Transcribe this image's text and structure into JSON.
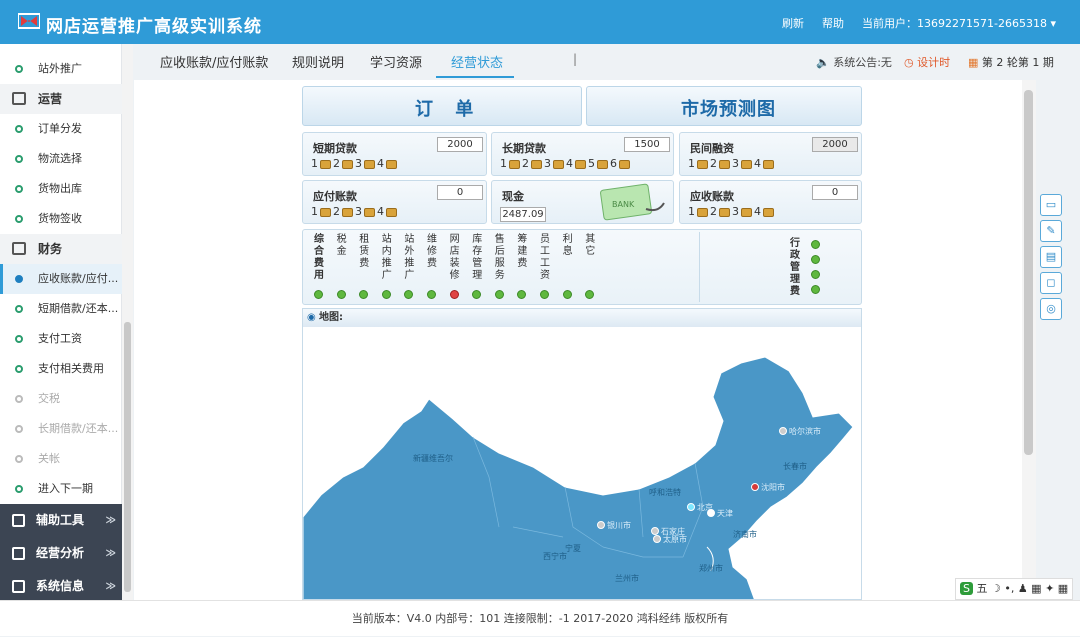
{
  "app": {
    "title": "网店运营推广高级实训系统",
    "refresh": "刷新",
    "help": "帮助",
    "user_label": "当前用户：",
    "user": "13692271571-2665318",
    "user_caret": "▾"
  },
  "sidebar": {
    "items": [
      {
        "label": "站外推广",
        "type": "item"
      },
      {
        "label": "运营",
        "type": "group"
      },
      {
        "label": "订单分发",
        "type": "item"
      },
      {
        "label": "物流选择",
        "type": "item"
      },
      {
        "label": "货物出库",
        "type": "item"
      },
      {
        "label": "货物签收",
        "type": "item"
      },
      {
        "label": "财务",
        "type": "group"
      },
      {
        "label": "应收账款/应付...",
        "type": "active"
      },
      {
        "label": "短期借款/还本...",
        "type": "item"
      },
      {
        "label": "支付工资",
        "type": "item"
      },
      {
        "label": "支付相关费用",
        "type": "item"
      },
      {
        "label": "交税",
        "type": "dim"
      },
      {
        "label": "长期借款/还本...",
        "type": "dim"
      },
      {
        "label": "关帐",
        "type": "dim"
      },
      {
        "label": "进入下一期",
        "type": "item"
      }
    ],
    "bottom": [
      {
        "label": "辅助工具"
      },
      {
        "label": "经营分析"
      },
      {
        "label": "系统信息"
      }
    ],
    "chevron": "≫"
  },
  "tabs": {
    "t1": "应收账款/应付账款",
    "t2": "规则说明",
    "t3": "学习资源",
    "sep": "|",
    "t4": "经营状态"
  },
  "status": {
    "notice": "系统公告:无",
    "timer": "设计时",
    "period": "第 2 轮第 1 期"
  },
  "banners": {
    "order": "订 单",
    "forecast": "市场预测图"
  },
  "finance": {
    "short_loan": {
      "label": "短期贷款",
      "value": "2000",
      "coins": [
        "1",
        "2",
        "3",
        "4"
      ]
    },
    "long_loan": {
      "label": "长期贷款",
      "value": "1500",
      "coins": [
        "1",
        "2",
        "3",
        "4",
        "5",
        "6"
      ]
    },
    "private_fund": {
      "label": "民间融资",
      "value": "2000",
      "coins": [
        "1",
        "2",
        "3",
        "4"
      ]
    },
    "payable": {
      "label": "应付账款",
      "value": "0",
      "coins": [
        "1",
        "2",
        "3",
        "4"
      ]
    },
    "cash": {
      "label": "现金",
      "value": "2487.09",
      "bank": "BANK"
    },
    "receivable": {
      "label": "应收账款",
      "value": "0",
      "coins": [
        "1",
        "2",
        "3",
        "4"
      ]
    }
  },
  "fees": {
    "columns": [
      {
        "label": "综合费用",
        "status": "green"
      },
      {
        "label": "税金",
        "status": "green"
      },
      {
        "label": "租赁费",
        "status": "green"
      },
      {
        "label": "站内推广",
        "status": "green"
      },
      {
        "label": "站外推广",
        "status": "green"
      },
      {
        "label": "维修费",
        "status": "green"
      },
      {
        "label": "网店装修",
        "status": "red"
      },
      {
        "label": "库存管理",
        "status": "green"
      },
      {
        "label": "售后服务",
        "status": "green"
      },
      {
        "label": "筹建费",
        "status": "green"
      },
      {
        "label": "员工工资",
        "status": "green"
      },
      {
        "label": "利息",
        "status": "green"
      },
      {
        "label": "其它",
        "status": "green"
      }
    ],
    "admin": {
      "label": "行政管理费",
      "status": [
        "green",
        "green",
        "green",
        "green"
      ]
    }
  },
  "map": {
    "title": "地图:",
    "cities": [
      {
        "name": "哈尔滨市",
        "color": "#cccccc"
      },
      {
        "name": "沈阳市",
        "color": "#d43a3a"
      },
      {
        "name": "北京",
        "color": "#7fe7ff"
      },
      {
        "name": "天津",
        "color": "#ffffff"
      },
      {
        "name": "石家庄",
        "color": "#cccccc"
      },
      {
        "name": "太原市",
        "color": "#cccccc"
      },
      {
        "name": "银川市",
        "color": "#cccccc"
      }
    ],
    "regions": [
      "新疆维吾尔",
      "呼和浩特",
      "长春市",
      "宁夏",
      "西宁市",
      "兰州市",
      "济南市",
      "郑州市"
    ],
    "colors": {
      "land": "#4a97c7"
    }
  },
  "rightbar": [
    "▭",
    "✎",
    "▤",
    "◻",
    "◎"
  ],
  "footer": "当前版本：V4.0 内部号：101 连接限制：-1 2017-2020 鸿科经纬 版权所有",
  "ime": {
    "label": "五",
    "extras": "☽ •, ♟ ▦ ✦ ▦"
  },
  "colors": {
    "topbar": "#2f9bd7",
    "accent": "#2f9bd7",
    "sidebar_dark": "#3c4553"
  }
}
